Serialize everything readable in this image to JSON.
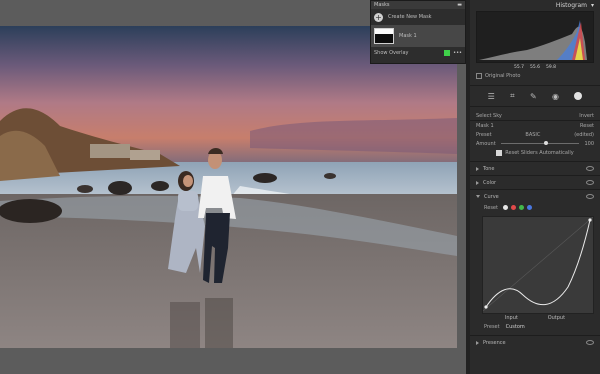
{
  "masks_panel": {
    "title": "Masks",
    "create_new_label": "Create New Mask",
    "mask_name": "Mask 1",
    "show_overlay_label": "Show Overlay",
    "overlay_color": "#3fd04a"
  },
  "sidebar": {
    "histogram_title": "Histogram",
    "histogram_values": [
      "55.7",
      "55.6",
      "59.8"
    ],
    "original_photo_label": "Original Photo",
    "select_sky_label": "Select Sky",
    "invert_label": "Invert",
    "mask_row": {
      "label": "Mask 1",
      "reset": "Reset"
    },
    "preset_row": {
      "label": "Preset",
      "value": "BASIC",
      "state": "(edited)"
    },
    "amount": {
      "label": "Amount",
      "value": "100"
    },
    "reset_sliders_label": "Reset Sliders Automatically",
    "sections": {
      "tone": "Tone",
      "color": "Color",
      "curve": "Curve",
      "presence": "Presence"
    },
    "curve_reset_label": "Reset",
    "curve_input_label": "Input",
    "curve_output_label": "Output",
    "curve_preset_label": "Preset",
    "curve_preset_value": "Custom"
  },
  "colors": {
    "channel_white": "#e6e6e6",
    "channel_red": "#e04a4a",
    "channel_green": "#43b84a",
    "channel_blue": "#4a78e0"
  }
}
